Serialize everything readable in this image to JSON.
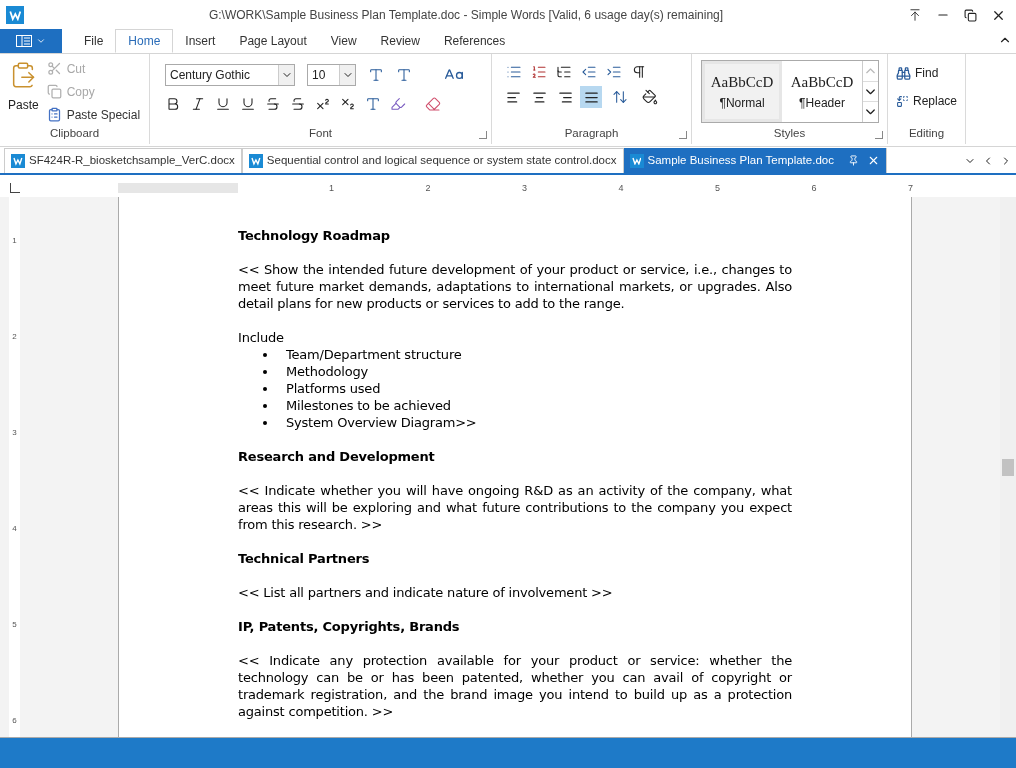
{
  "window": {
    "title": "G:\\WORK\\Sample Business Plan Template.doc - Simple Words [Valid, 6 usage day(s) remaining]"
  },
  "ribbon_tabs": [
    {
      "label": "File",
      "selected": false
    },
    {
      "label": "Home",
      "selected": true
    },
    {
      "label": "Insert",
      "selected": false
    },
    {
      "label": "Page Layout",
      "selected": false
    },
    {
      "label": "View",
      "selected": false
    },
    {
      "label": "Review",
      "selected": false
    },
    {
      "label": "References",
      "selected": false
    }
  ],
  "clipboard": {
    "group": "Clipboard",
    "paste": "Paste",
    "items": [
      {
        "label": "Cut",
        "disabled": true
      },
      {
        "label": "Copy",
        "disabled": true
      },
      {
        "label": "Paste Special",
        "disabled": false
      }
    ]
  },
  "font": {
    "group": "Font",
    "family": "Century Gothic",
    "size": "10"
  },
  "paragraph": {
    "group": "Paragraph",
    "alignments": [
      {
        "kind": "left",
        "selected": false
      },
      {
        "kind": "center",
        "selected": false
      },
      {
        "kind": "right",
        "selected": false
      },
      {
        "kind": "justify",
        "selected": true
      }
    ]
  },
  "styles": {
    "group": "Styles",
    "items": [
      {
        "sample": "AaBbCcD",
        "label": "¶Normal",
        "selected": true
      },
      {
        "sample": "AaBbCcD",
        "label": "¶Header",
        "selected": false
      }
    ]
  },
  "editing": {
    "group": "Editing",
    "find": "Find",
    "replace": "Replace"
  },
  "document_tabs": [
    {
      "label": "SF424R-R_biosketchsample_VerC.docx",
      "selected": false
    },
    {
      "label": "Sequential control and logical sequence or system state control.docx",
      "selected": false
    },
    {
      "label": "Sample Business Plan Template.doc",
      "selected": true
    }
  ],
  "ruler": {
    "marks": [
      "1",
      "2",
      "3",
      "4",
      "5",
      "6",
      "7"
    ],
    "vertical_marks": [
      "1",
      "2",
      "3",
      "4",
      "5",
      "6"
    ]
  },
  "document": {
    "blocks": [
      {
        "kind": "heading",
        "text": "Technology Roadmap"
      },
      {
        "kind": "paragraph",
        "text": "<< Show the intended future development of your product or service, i.e., changes to meet future market demands, adaptations to international markets, or upgrades.  Also detail plans for new products or services to add to the range."
      },
      {
        "kind": "plain",
        "text": "Include"
      },
      {
        "kind": "list",
        "items": [
          "Team/Department structure",
          "Methodology",
          "Platforms used",
          "Milestones to be achieved",
          "System Overview Diagram>>"
        ]
      },
      {
        "kind": "heading",
        "text": "Research and Development"
      },
      {
        "kind": "paragraph",
        "text": "<< Indicate whether you will have ongoing R&D as an activity of the company, what areas this will be exploring and what future contributions to the company you expect from this research. >>"
      },
      {
        "kind": "heading",
        "text": "Technical Partners"
      },
      {
        "kind": "paragraph",
        "text": "<< List all partners and indicate nature of involvement >>"
      },
      {
        "kind": "heading",
        "text": "IP, Patents, Copyrights, Brands"
      },
      {
        "kind": "paragraph",
        "text": "<< Indicate any protection available for your product or service: whether the technology can be or has been patented, whether you can avail of copyright or trademark registration, and the brand image you intend to build up as a protection against competition. >>"
      }
    ]
  }
}
